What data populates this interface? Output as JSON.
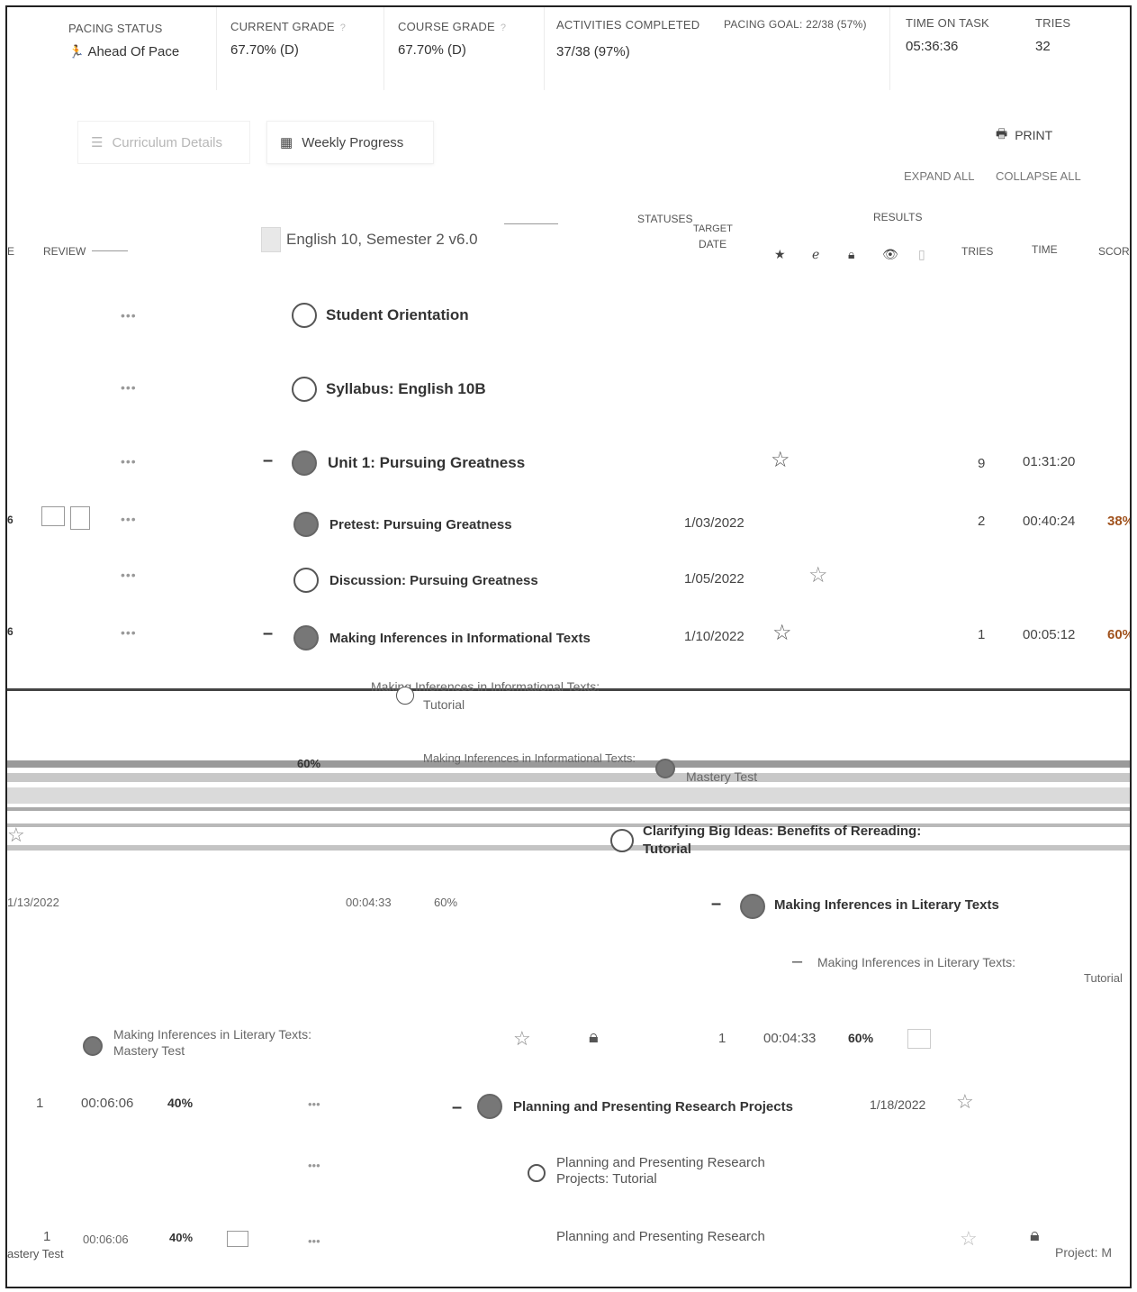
{
  "stats": {
    "pacing_status": {
      "label": "PACING STATUS",
      "value": "Ahead Of Pace"
    },
    "current_grade": {
      "label": "CURRENT GRADE",
      "value": "67.70% (D)"
    },
    "course_grade": {
      "label": "COURSE GRADE",
      "value": "67.70% (D)"
    },
    "activities_completed": {
      "label": "ACTIVITIES COMPLETED",
      "value": "37/38 (97%)"
    },
    "pacing_goal": {
      "label": "PACING GOAL: 22/38 (57%)"
    },
    "time_on_task": {
      "label": "TIME ON TASK",
      "value": "05:36:36"
    },
    "tries": {
      "label": "TRIES",
      "value": "32"
    },
    "help_mark": "?"
  },
  "tabs": [
    {
      "label": "Curriculum Details",
      "icon": "list-icon",
      "active": false
    },
    {
      "label": "Weekly Progress",
      "icon": "calendar-grid-icon",
      "active": true
    }
  ],
  "actions": {
    "print": "PRINT",
    "expand_all": "EXPAND ALL",
    "collapse_all": "COLLAPSE ALL"
  },
  "table_header": {
    "review": "REVIEW",
    "course_title": "English 10, Semester 2 v6.0",
    "statuses": "STATUSES",
    "target": "TARGET",
    "date": "DATE",
    "results": "RESULTS",
    "tries": "TRIES",
    "time": "TIME",
    "score": "SCOR",
    "edge_e": "E"
  },
  "rows": [
    {
      "title": "Student Orientation",
      "state": "open"
    },
    {
      "title": "Syllabus: English 10B",
      "state": "open"
    },
    {
      "title": "Unit 1: Pursuing Greatness",
      "state": "filled",
      "collapse": "–",
      "tries": "9",
      "time": "01:31:20"
    },
    {
      "title": "Pretest: Pursuing Greatness",
      "state": "filled",
      "date": "1/03/2022",
      "tries": "2",
      "time": "00:40:24",
      "score": "38%"
    },
    {
      "title": "Discussion: Pursuing Greatness",
      "state": "open",
      "date": "1/05/2022"
    },
    {
      "title": "Making Inferences in Informational Texts",
      "state": "filled",
      "collapse": "–",
      "date": "1/10/2022",
      "tries": "1",
      "time": "00:05:12",
      "score": "60%"
    }
  ],
  "more_actions": "•••",
  "glitch": {
    "t1": "Making Inferences in Informational Texts:",
    "t1b": "Tutorial",
    "t2": "Making Inferences in Informational Texts:",
    "t2b": "Mastery Test",
    "t2pct": "60%",
    "t3": "Clarifying Big Ideas: Benefits of Rereading:",
    "t3b": "Tutorial",
    "t4date": "1/13/2022",
    "t4time": "00:04:33",
    "t4pct": "60%",
    "t4title": "Making Inferences in Literary Texts",
    "t5": "Making Inferences in Literary Texts:",
    "t5b": "Tutorial",
    "t6": "Making Inferences in Literary Texts:",
    "t6b": "Mastery Test",
    "t6tries": "1",
    "t6time": "00:04:33",
    "t6pct": "60%",
    "t7tries": "1",
    "t7time": "00:06:06",
    "t7pct": "40%",
    "t7title": "Planning and Presenting Research Projects",
    "t7date": "1/18/2022",
    "t8": "Planning and Presenting Research",
    "t8b": "Projects: Tutorial",
    "t9tries": "1",
    "t9time": "00:06:06",
    "t9pct": "40%",
    "t9title": "Planning and Presenting Research",
    "t9left": "astery Test",
    "t9right": "Project: M"
  }
}
